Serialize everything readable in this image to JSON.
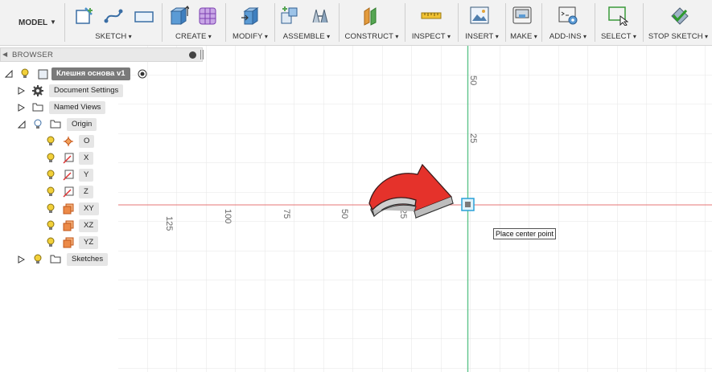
{
  "toolbar": {
    "model": "MODEL",
    "groups": {
      "sketch": "SKETCH",
      "create": "CREATE",
      "modify": "MODIFY",
      "assemble": "ASSEMBLE",
      "construct": "CONSTRUCT",
      "inspect": "INSPECT",
      "insert": "INSERT",
      "make": "MAKE",
      "addins": "ADD-INS",
      "select": "SELECT",
      "stop_sketch": "STOP SKETCH"
    }
  },
  "browser": {
    "title": "BROWSER",
    "root": "Клешня основа v1",
    "items": {
      "doc_settings": "Document Settings",
      "named_views": "Named Views",
      "origin": "Origin",
      "o": "O",
      "x": "X",
      "y": "Y",
      "z": "Z",
      "xy": "XY",
      "xz": "XZ",
      "yz": "YZ",
      "sketches": "Sketches"
    }
  },
  "canvas": {
    "x_ruler": [
      "125",
      "100",
      "75",
      "50",
      "25"
    ],
    "y_ruler": [
      "50",
      "25"
    ],
    "tooltip": "Place center point"
  },
  "colors": {
    "x_axis": "#e36a6a",
    "y_axis": "#5ec48a",
    "grid": "#e4e4e4",
    "arrow": "#e5322b",
    "bulb": "#f2d03a"
  }
}
